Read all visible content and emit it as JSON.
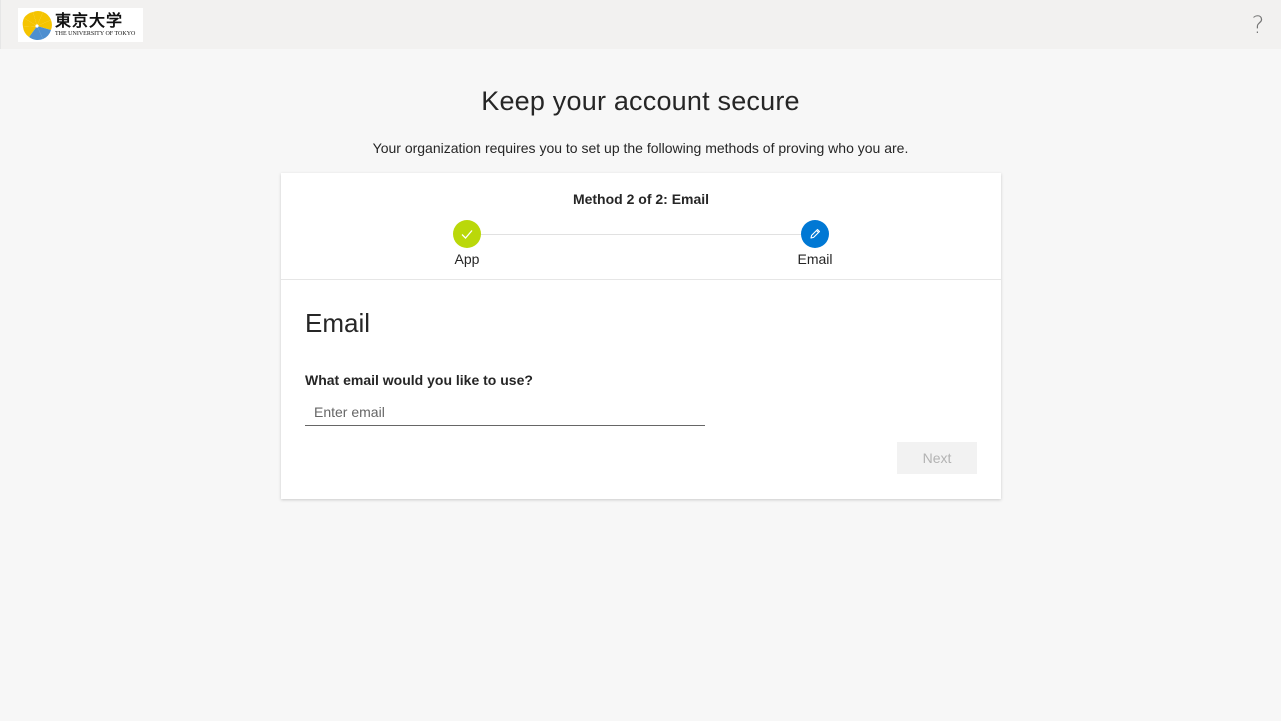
{
  "header": {
    "logo": {
      "kanji": "東京大学",
      "english": "THE UNIVERSITY OF TOKYO"
    },
    "help_label": "?"
  },
  "page": {
    "title": "Keep your account secure",
    "subtitle": "Your organization requires you to set up the following methods of proving who you are."
  },
  "wizard": {
    "method_title": "Method 2 of 2: Email",
    "steps": [
      {
        "label": "App",
        "status": "complete",
        "color": "#bad80a",
        "icon": "check-icon"
      },
      {
        "label": "Email",
        "status": "current",
        "color": "#0078d4",
        "icon": "pencil-icon"
      }
    ]
  },
  "form": {
    "section_title": "Email",
    "question": "What email would you like to use?",
    "email_value": "",
    "email_placeholder": "Enter email",
    "next_label": "Next",
    "next_disabled": true
  },
  "colors": {
    "accent": "#0078d4",
    "complete": "#bad80a",
    "background": "#f7f7f7",
    "topbar": "#f2f1f0"
  }
}
